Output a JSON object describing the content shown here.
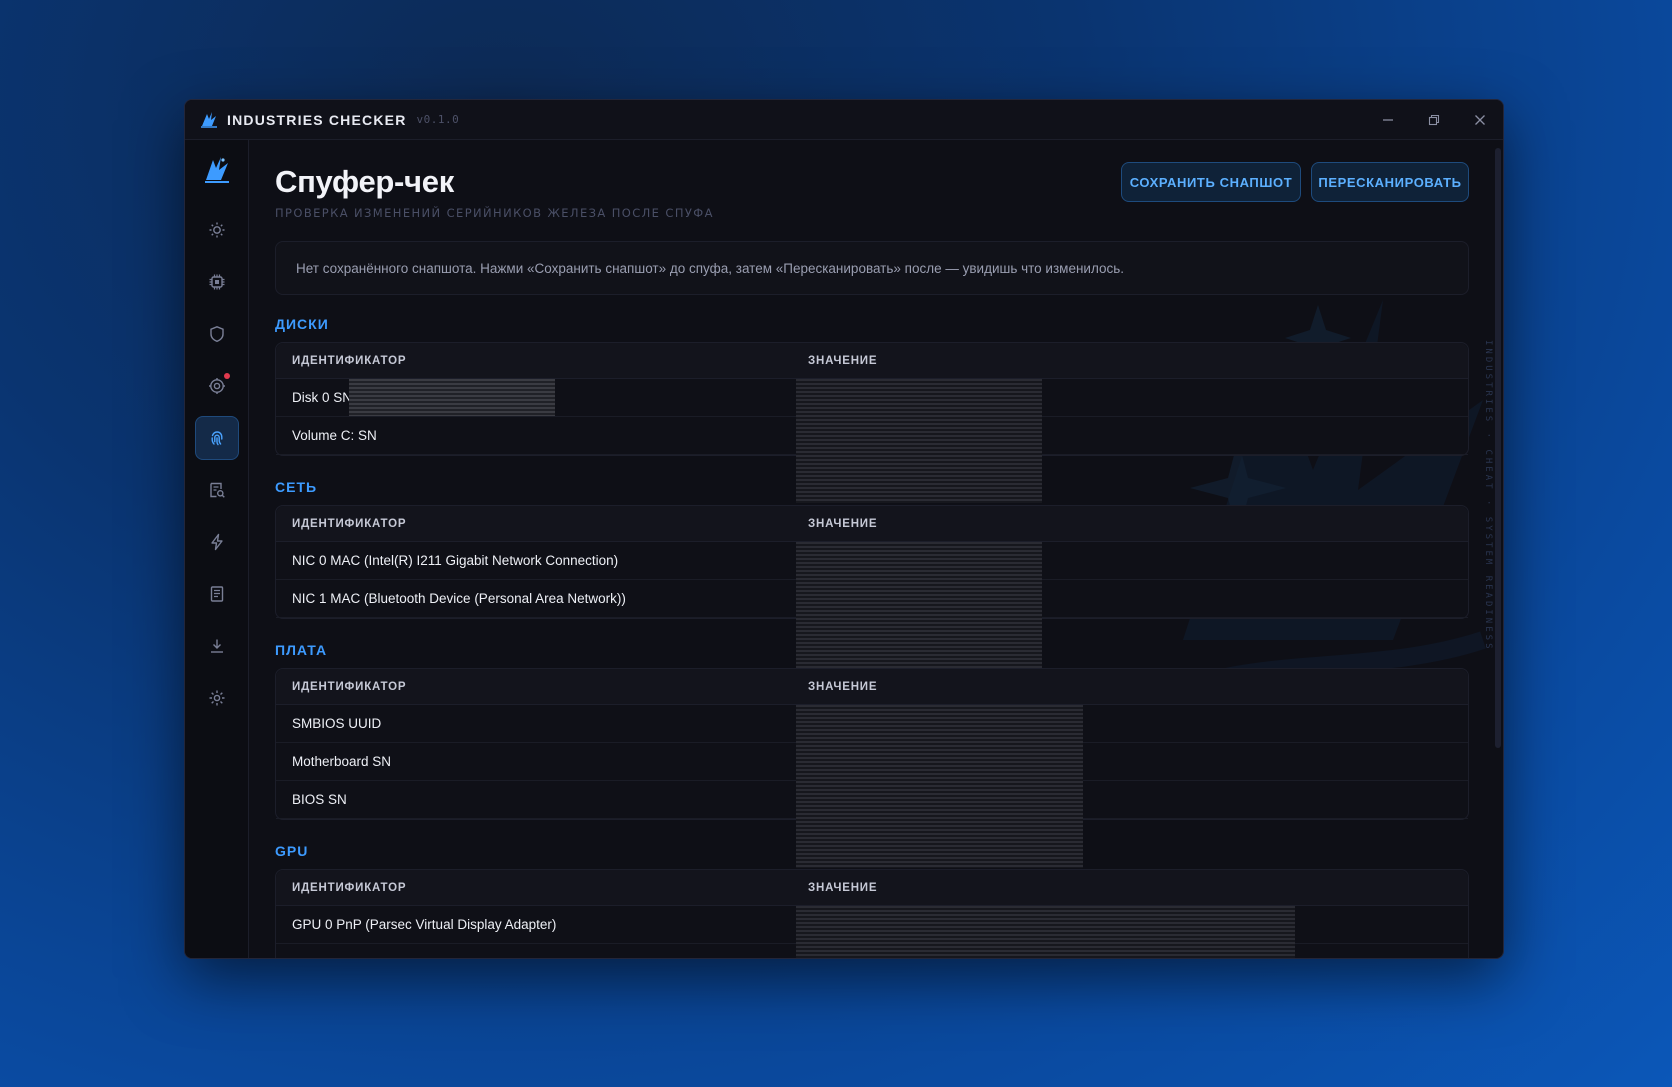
{
  "app": {
    "title": "INDUSTRIES CHECKER",
    "version": "v0.1.0"
  },
  "window_controls": [
    "minimize-icon",
    "restore-icon",
    "close-icon"
  ],
  "sidebar": {
    "items": [
      {
        "icon": "sun-icon",
        "active": false
      },
      {
        "icon": "chip-icon",
        "active": false
      },
      {
        "icon": "shield-icon",
        "active": false
      },
      {
        "icon": "target-icon",
        "active": false,
        "badge": true
      },
      {
        "icon": "fingerprint-icon",
        "active": true
      },
      {
        "icon": "search-list-icon",
        "active": false
      },
      {
        "icon": "bolt-icon",
        "active": false
      },
      {
        "icon": "document-icon",
        "active": false
      },
      {
        "icon": "download-icon",
        "active": false
      },
      {
        "icon": "settings-icon",
        "active": false
      }
    ]
  },
  "page": {
    "title": "Спуфер-чек",
    "subtitle": "ПРОВЕРКА ИЗМЕНЕНИЙ СЕРИЙНИКОВ ЖЕЛЕЗА ПОСЛЕ СПУФА",
    "save_label": "СОХРАНИТЬ СНАПШОТ",
    "rescan_label": "ПЕРЕСКАНИРОВАТЬ",
    "notice": "Нет сохранённого снапшота. Нажми «Сохранить снапшот» до спуфа, затем «Пересканировать» после — увидишь что изменилось.",
    "vertical_text": "INDUSTRIES · CHEAT · SYSTEM READINESS"
  },
  "table_headers": {
    "id": "ИДЕНТИФИКАТОР",
    "value": "ЗНАЧЕНИЕ"
  },
  "sections": {
    "disks": {
      "title": "ДИСКИ",
      "rows": [
        "Disk 0 SN",
        "Volume C: SN"
      ]
    },
    "network": {
      "title": "СЕТЬ",
      "rows": [
        "NIC 0 MAC (Intel(R) I211 Gigabit Network Connection)",
        "NIC 1 MAC (Bluetooth Device (Personal Area Network))"
      ]
    },
    "board": {
      "title": "ПЛАТА",
      "rows": [
        "SMBIOS UUID",
        "Motherboard SN",
        "BIOS SN"
      ]
    },
    "gpu": {
      "title": "GPU",
      "rows": [
        "GPU 0 PnP (Parsec Virtual Display Adapter)"
      ]
    }
  },
  "colors": {
    "accent": "#3d9bff",
    "background": "#0e0f16",
    "badge": "#e23a4e"
  }
}
